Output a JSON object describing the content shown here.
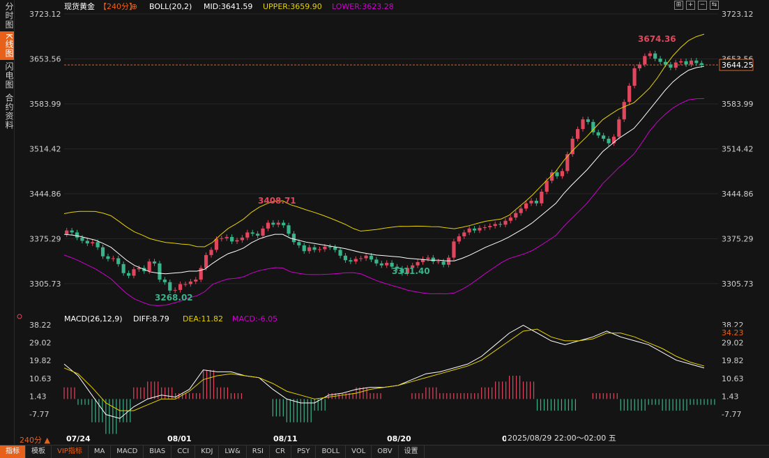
{
  "sidebar": {
    "tabs": [
      {
        "label": "分时图",
        "active": false
      },
      {
        "label": "K线图",
        "active": true
      },
      {
        "label": "闪电图",
        "active": false
      },
      {
        "label": "合约资料",
        "active": false
      }
    ]
  },
  "header": {
    "symbol": "现货黄金",
    "period": "【240分】",
    "gear_icon": "⊕",
    "indicator_icon": "bollinger-icon",
    "boll": "BOLL(20,2)",
    "mid": "MID:3641.59",
    "upper": "UPPER:3659.90",
    "lower": "LOWER:3623.28"
  },
  "colors": {
    "up": "#e0475e",
    "down": "#38b48a",
    "mid": "#ffffff",
    "upper": "#e6d200",
    "lower": "#d000d0",
    "accent": "#e8611a",
    "diff": "#ffffff",
    "dea": "#e6d200"
  },
  "price_axis": {
    "ticks": [
      "3723.12",
      "3653.56",
      "3583.99",
      "3514.42",
      "3444.86",
      "3375.29",
      "3305.73"
    ],
    "current": "3644.25"
  },
  "annotations": {
    "high": "3674.36",
    "peak2": "3408.71",
    "low1": "3268.02",
    "low2": "3311.40"
  },
  "macd": {
    "header": "MACD(26,12,9)",
    "diff": "DIFF:8.79",
    "dea": "DEA:11.82",
    "macd": "MACD:-6.05",
    "ticks": [
      "38.22",
      "29.02",
      "19.82",
      "10.63",
      "1.43",
      "-7.77"
    ],
    "current": "34.23"
  },
  "xaxis": {
    "labels": [
      "07/24",
      "08/01",
      "08/11",
      "08/20",
      "08/"
    ],
    "cursor": "2025/08/29 22:00～02:00 五"
  },
  "timeframe": "240分 ▲",
  "bottom_tabs": [
    {
      "label": "指标",
      "style": "active"
    },
    {
      "label": "模板",
      "style": "normal"
    },
    {
      "label": "VIP指标",
      "style": "vip"
    },
    {
      "label": "MA",
      "style": "normal"
    },
    {
      "label": "MACD",
      "style": "normal"
    },
    {
      "label": "BIAS",
      "style": "normal"
    },
    {
      "label": "CCI",
      "style": "normal"
    },
    {
      "label": "KDJ",
      "style": "normal"
    },
    {
      "label": "LW&",
      "style": "normal"
    },
    {
      "label": "RSI",
      "style": "normal"
    },
    {
      "label": "CR",
      "style": "normal"
    },
    {
      "label": "PSY",
      "style": "normal"
    },
    {
      "label": "BOLL",
      "style": "normal"
    },
    {
      "label": "VOL",
      "style": "normal"
    },
    {
      "label": "OBV",
      "style": "normal"
    },
    {
      "label": "设置",
      "style": "normal"
    }
  ],
  "chart_data": {
    "type": "line",
    "title": "现货黄金 240分",
    "price_range": [
      3270,
      3723.12
    ],
    "close": [
      3388,
      3385,
      3377,
      3372,
      3368,
      3370,
      3362,
      3348,
      3344,
      3345,
      3336,
      3322,
      3318,
      3328,
      3330,
      3325,
      3340,
      3337,
      3312,
      3308,
      3295,
      3296,
      3305,
      3305,
      3309,
      3312,
      3330,
      3350,
      3358,
      3375,
      3376,
      3378,
      3371,
      3373,
      3377,
      3385,
      3383,
      3380,
      3391,
      3400,
      3397,
      3400,
      3396,
      3383,
      3370,
      3365,
      3356,
      3362,
      3358,
      3359,
      3363,
      3362,
      3358,
      3349,
      3342,
      3340,
      3344,
      3345,
      3349,
      3343,
      3337,
      3334,
      3338,
      3332,
      3329,
      3322,
      3330,
      3334,
      3339,
      3344,
      3346,
      3340,
      3340,
      3335,
      3346,
      3371,
      3379,
      3385,
      3391,
      3388,
      3392,
      3393,
      3395,
      3398,
      3397,
      3403,
      3408,
      3415,
      3422,
      3430,
      3434,
      3430,
      3448,
      3465,
      3478,
      3472,
      3480,
      3506,
      3530,
      3545,
      3560,
      3556,
      3540,
      3535,
      3530,
      3523,
      3533,
      3560,
      3587,
      3612,
      3639,
      3645,
      3658,
      3662,
      3654,
      3649,
      3645,
      3640,
      3648,
      3650,
      3645,
      3651,
      3647,
      3644
    ],
    "mid": [
      3382,
      3381,
      3379,
      3376,
      3373,
      3368,
      3362,
      3352,
      3342,
      3334,
      3329,
      3324,
      3322,
      3321,
      3322,
      3323,
      3325,
      3325,
      3328,
      3337,
      3345,
      3352,
      3356,
      3361,
      3369,
      3375,
      3379,
      3382,
      3382,
      3376,
      3373,
      3370,
      3368,
      3366,
      3364,
      3362,
      3360,
      3357,
      3354,
      3352,
      3350,
      3349,
      3348,
      3347,
      3345,
      3344,
      3343,
      3342,
      3342,
      3341,
      3341,
      3345,
      3350,
      3356,
      3362,
      3367,
      3372,
      3378,
      3385,
      3392,
      3400,
      3410,
      3420,
      3430,
      3445,
      3458,
      3470,
      3482,
      3496,
      3510,
      3520,
      3530,
      3538,
      3546,
      3560,
      3575,
      3590,
      3605,
      3618,
      3628,
      3636,
      3640,
      3642
    ],
    "macd_series": [
      {
        "name": "DIFF",
        "values": [
          18,
          12,
          2,
          -8,
          -10,
          -4,
          0,
          2,
          1,
          5,
          15,
          14,
          14,
          12,
          11,
          5,
          0,
          -2,
          -2,
          2,
          3,
          5,
          6,
          6,
          7,
          10,
          13,
          14,
          16,
          18,
          22,
          28,
          34,
          38,
          34,
          30,
          28,
          30,
          32,
          35,
          32,
          30,
          28,
          24,
          20,
          18,
          16
        ]
      },
      {
        "name": "DEA",
        "values": [
          16,
          13,
          6,
          -2,
          -6,
          -6,
          -3,
          0,
          0,
          4,
          10,
          12,
          13,
          12,
          11,
          8,
          4,
          2,
          0,
          1,
          2,
          3,
          5,
          6,
          7,
          9,
          11,
          13,
          15,
          17,
          20,
          25,
          30,
          35,
          36,
          32,
          30,
          30,
          31,
          34,
          34,
          32,
          29,
          26,
          22,
          19,
          17
        ]
      }
    ],
    "macd_range": [
      -7.77,
      38.22
    ]
  }
}
